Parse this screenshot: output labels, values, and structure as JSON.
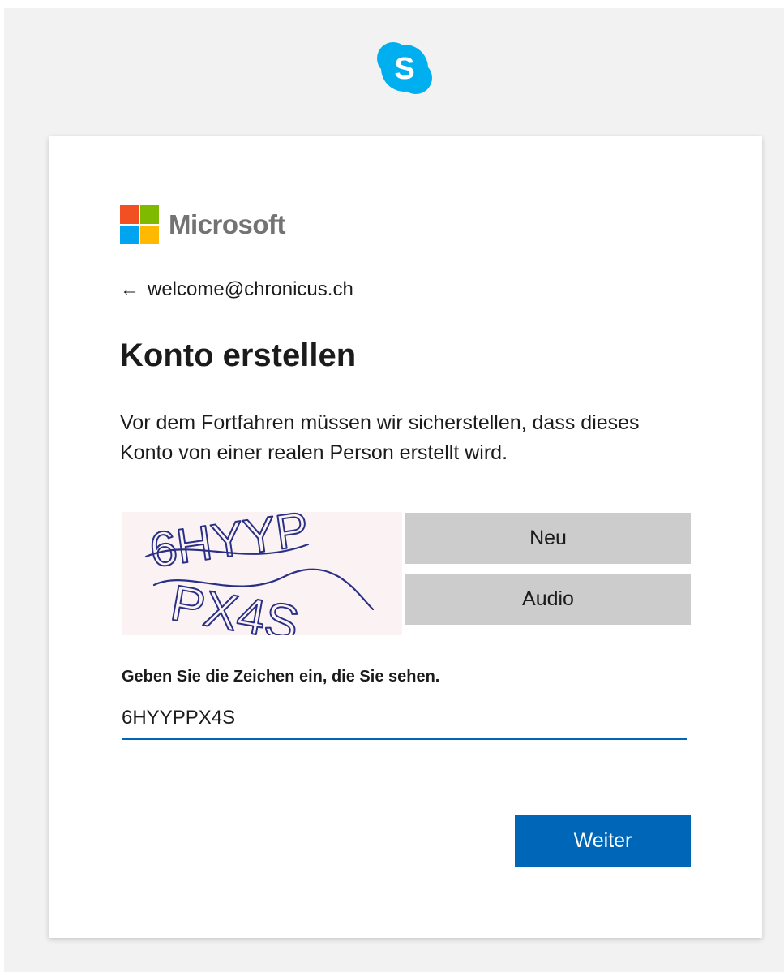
{
  "skype": {
    "icon": "skype-logo-icon",
    "letter": "S",
    "color": "#00aff0"
  },
  "brand": {
    "name": "Microsoft",
    "colors": [
      "#f25022",
      "#7fba00",
      "#00a4ef",
      "#ffb900"
    ]
  },
  "identity": {
    "back_icon": "back-arrow-icon",
    "arrow": "←",
    "email": "welcome@chronicus.ch"
  },
  "heading": "Konto erstellen",
  "description": "Vor dem Fortfahren müssen wir sicherstellen, dass dieses Konto von einer realen Person erstellt wird.",
  "captcha": {
    "image_text": "6HYYP PX4S",
    "new_label": "Neu",
    "audio_label": "Audio",
    "input_label": "Geben Sie die Zeichen ein, die Sie sehen.",
    "input_value": "6HYYPPX4S"
  },
  "actions": {
    "next_label": "Weiter",
    "accent_color": "#0067b8"
  }
}
